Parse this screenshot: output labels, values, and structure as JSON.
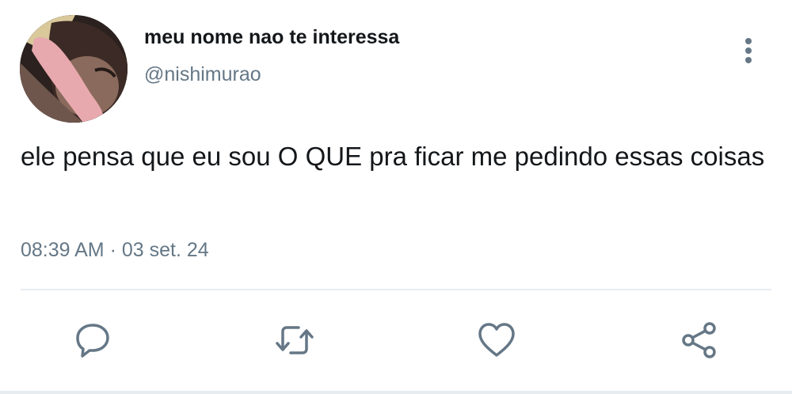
{
  "tweet": {
    "author": {
      "display_name": "meu nome nao te interessa",
      "handle": "@nishimurao"
    },
    "text": "ele pensa que eu sou O QUE pra ficar me pedindo essas coisas",
    "time": "08:39 AM",
    "separator": "·",
    "date": "03 set. 24"
  },
  "actions": [
    {
      "name": "reply",
      "icon": "reply-icon"
    },
    {
      "name": "retweet",
      "icon": "retweet-icon"
    },
    {
      "name": "like",
      "icon": "heart-icon"
    },
    {
      "name": "share",
      "icon": "share-icon"
    }
  ],
  "colors": {
    "text": "#14171a",
    "secondary": "#657786",
    "divider": "#e6ecf0"
  }
}
